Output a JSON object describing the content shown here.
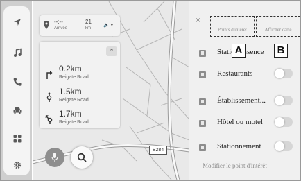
{
  "eta": {
    "time": "--:--",
    "time_label": "Arrivée",
    "distance": "21",
    "distance_unit": "km",
    "volume_glyph": "🔈 ▾"
  },
  "turns": [
    {
      "distance": "0.2km",
      "road": "Reigate Road"
    },
    {
      "distance": "1.5km",
      "road": "Reigate Road"
    },
    {
      "distance": "1.7km",
      "road": "Reigate Road"
    }
  ],
  "map": {
    "road_label": "B284"
  },
  "panel": {
    "close_glyph": "×",
    "tab_poi": "Points d'intérêt",
    "tab_show_map": "Afficher carte",
    "callout_a": "A",
    "callout_b": "B",
    "items": [
      {
        "label": "Station essence",
        "icon": "fuel-pump-icon"
      },
      {
        "label": "Restaurants",
        "icon": "restaurant-icon"
      },
      {
        "label": "Établissement...",
        "icon": "building-icon"
      },
      {
        "label": "Hôtel ou motel",
        "icon": "bed-icon"
      },
      {
        "label": "Stationnement",
        "icon": "parking-icon"
      }
    ],
    "modify_label": "Modifier le point d'intérêt"
  }
}
